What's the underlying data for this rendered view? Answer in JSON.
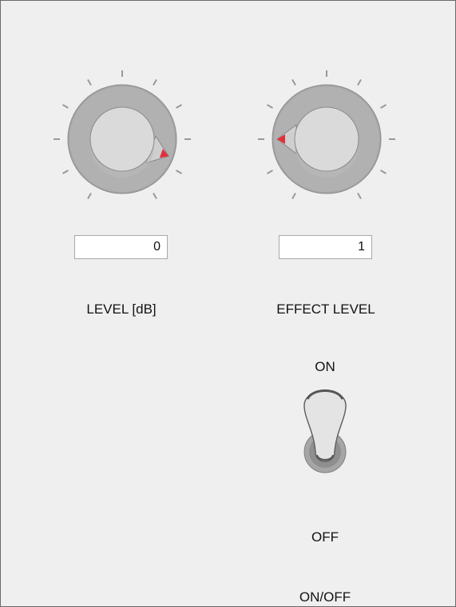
{
  "controls": {
    "level": {
      "label": "LEVEL [dB]",
      "value": "0",
      "knob_angle_deg": 110
    },
    "effect": {
      "label": "EFFECT LEVEL",
      "value": "1",
      "knob_angle_deg": -90
    }
  },
  "switch": {
    "on_label": "ON",
    "off_label": "OFF",
    "name_label": "ON/OFF",
    "state": "ON"
  },
  "colors": {
    "background": "#f0f0f0",
    "knob_outer": "#a9a9a9",
    "knob_cap": "#dcdcdc",
    "pointer": "#e0303a",
    "tick": "#999999"
  }
}
